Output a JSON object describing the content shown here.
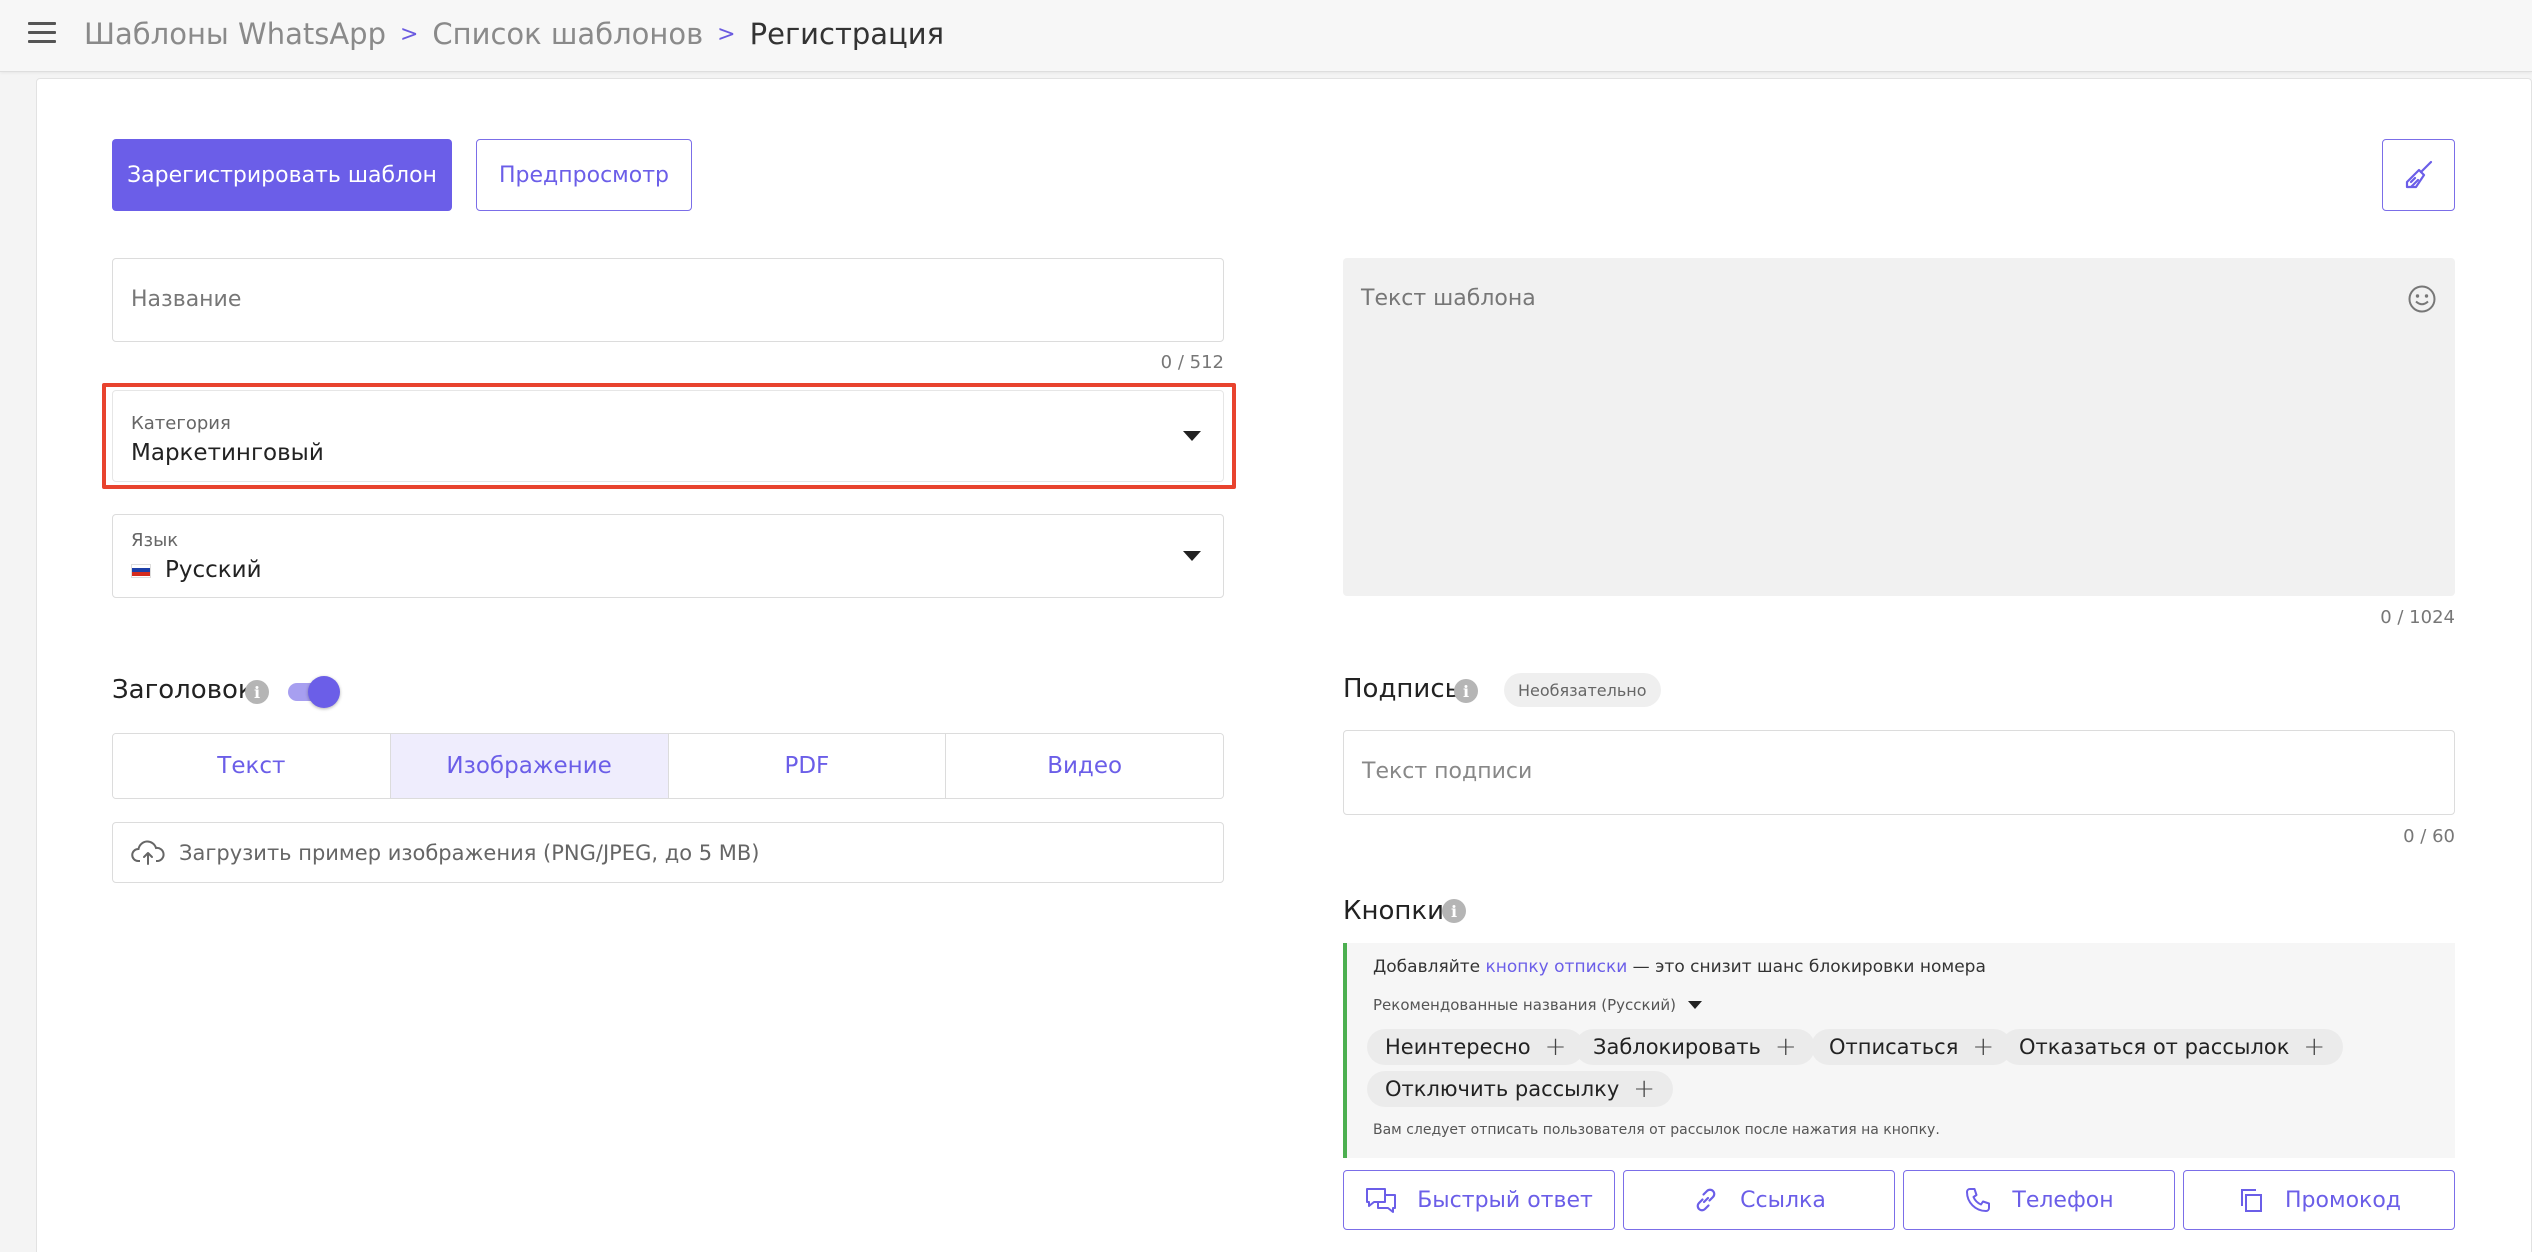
{
  "breadcrumb": {
    "items": [
      "Шаблоны WhatsApp",
      "Список шаблонов"
    ],
    "current": "Регистрация",
    "separator": ">"
  },
  "toolbar": {
    "register_label": "Зарегистрировать шаблон",
    "preview_label": "Предпросмотр",
    "clear_icon": "broom-icon"
  },
  "form": {
    "name": {
      "placeholder": "Название",
      "value": "",
      "counter": "0 / 512"
    },
    "category": {
      "label": "Категория",
      "value": "Маркетинговый"
    },
    "language": {
      "label": "Язык",
      "value": "Русский",
      "flag": "ru"
    },
    "header": {
      "title": "Заголовок",
      "enabled": true,
      "tabs": [
        "Текст",
        "Изображение",
        "PDF",
        "Видео"
      ],
      "active_tab": "Изображение",
      "upload_label": "Загрузить пример изображения (PNG/JPEG, до 5 MB)"
    },
    "template_text": {
      "placeholder": "Текст шаблона",
      "value": "",
      "counter": "0 / 1024"
    },
    "signature": {
      "title": "Подпись",
      "badge": "Необязательно",
      "placeholder": "Текст подписи",
      "counter": "0 / 60"
    },
    "buttons": {
      "title": "Кнопки",
      "hint_prefix": "Добавляйте ",
      "hint_link": "кнопку отписки",
      "hint_suffix": " — это снизит шанс блокировки номера",
      "recommended_label": "Рекомендованные названия (Русский)",
      "chips": [
        "Неинтересно",
        "Заблокировать",
        "Отписаться",
        "Отказаться от рассылок",
        "Отключить рассылку"
      ],
      "note": "Вам следует отписать пользователя от рассылок после нажатия на кнопку.",
      "actions": [
        "Быстрый ответ",
        "Ссылка",
        "Телефон",
        "Промокод"
      ]
    }
  },
  "colors": {
    "accent": "#6b5ee8",
    "highlight": "#e8432e",
    "success_bar": "#4caf50"
  }
}
